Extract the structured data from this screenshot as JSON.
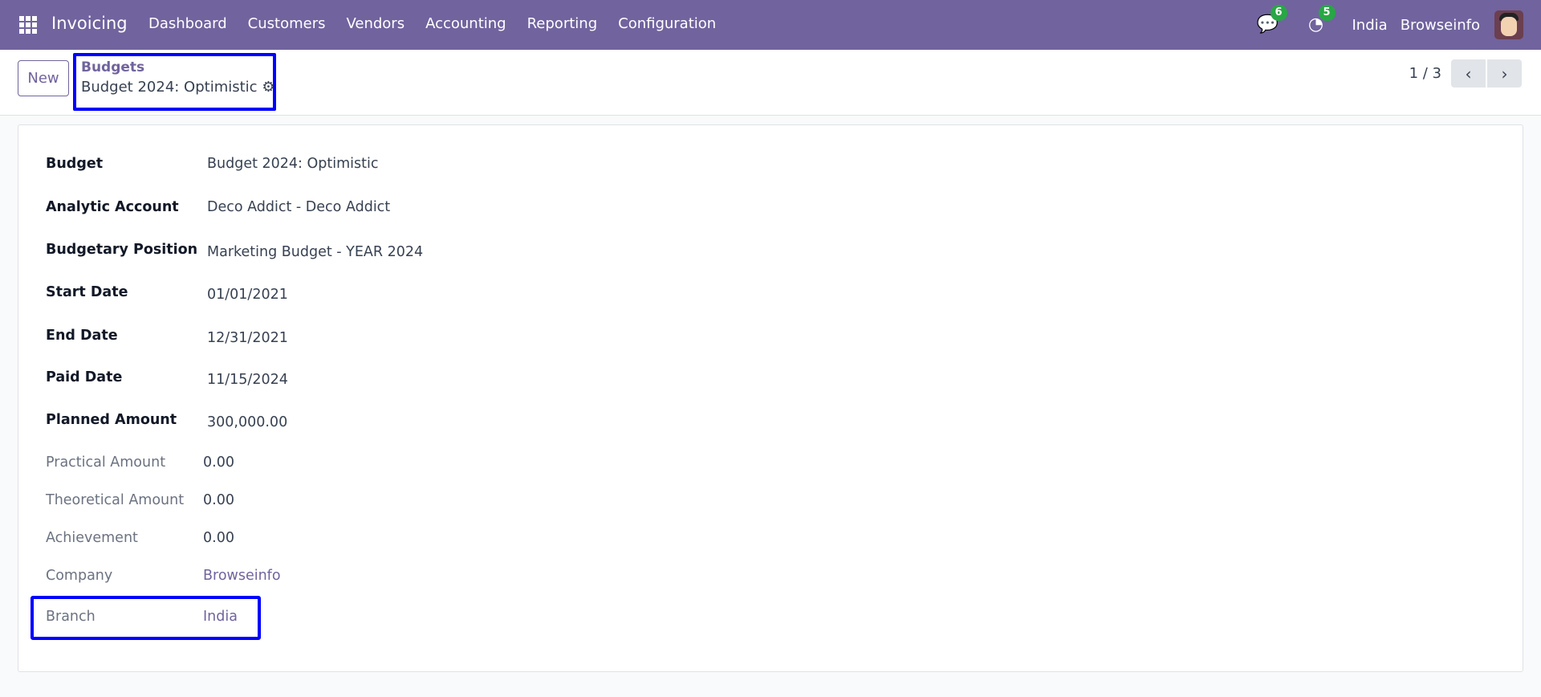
{
  "navbar": {
    "app": "Invoicing",
    "menu": [
      "Dashboard",
      "Customers",
      "Vendors",
      "Accounting",
      "Reporting",
      "Configuration"
    ],
    "messages_count": "6",
    "activities_count": "5",
    "branch": "India",
    "company": "Browseinfo",
    "accent": "#71639e"
  },
  "control_panel": {
    "new_label": "New",
    "breadcrumb_parent": "Budgets",
    "record_title": "Budget 2024: Optimistic",
    "pager": "1 / 3"
  },
  "form": {
    "fields": [
      {
        "label": "Budget",
        "value": "Budget 2024: Optimistic"
      },
      {
        "label": "Analytic Account",
        "value": "Deco Addict - Deco Addict"
      },
      {
        "label": "Budgetary Position",
        "value": "Marketing Budget - YEAR 2024"
      },
      {
        "label": "Start Date",
        "value": "01/01/2021"
      },
      {
        "label": "End Date",
        "value": "12/31/2021"
      },
      {
        "label": "Paid Date",
        "value": "11/15/2024"
      },
      {
        "label": "Planned Amount",
        "value": "300,000.00"
      },
      {
        "label": "Practical Amount",
        "value": "0.00"
      },
      {
        "label": "Theoretical Amount",
        "value": "0.00"
      },
      {
        "label": "Achievement",
        "value": "0.00"
      },
      {
        "label": "Company",
        "value": "Browseinfo"
      },
      {
        "label": "Branch",
        "value": "India"
      }
    ]
  }
}
